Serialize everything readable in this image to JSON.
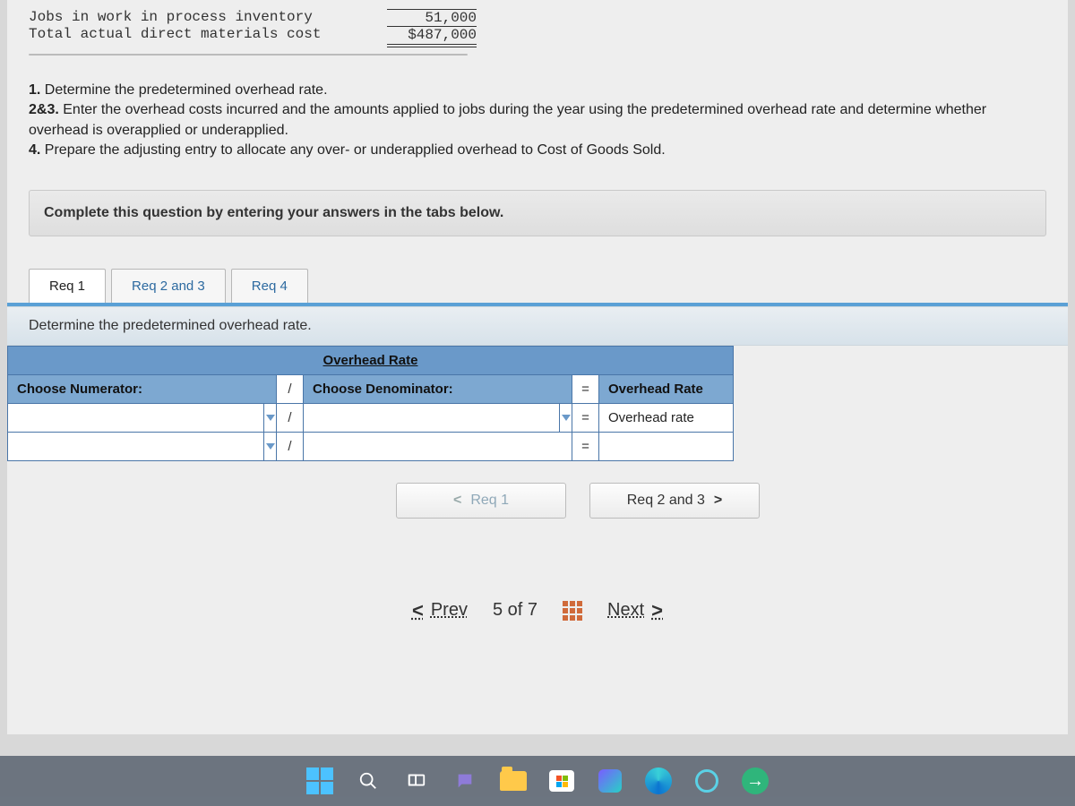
{
  "mono": {
    "row1_label": "Jobs in work in process inventory",
    "row1_value": "51,000",
    "row2_label": "Total actual direct materials cost",
    "row2_value": "$487,000"
  },
  "instructions": {
    "l1b": "1.",
    "l1": " Determine the predetermined overhead rate.",
    "l2b": "2&3.",
    "l2": " Enter the overhead costs incurred and the amounts applied to jobs during the year using the predetermined overhead rate and determine whether overhead is overapplied or underapplied.",
    "l3b": "4.",
    "l3": " Prepare the adjusting entry to allocate any over- or underapplied overhead to Cost of Goods Sold."
  },
  "complete_banner": "Complete this question by entering your answers in the tabs below.",
  "tabs": {
    "t1": "Req 1",
    "t2": "Req 2 and 3",
    "t3": "Req 4"
  },
  "sub_instruction": "Determine the predetermined overhead rate.",
  "table": {
    "header": "Overhead Rate",
    "numerator_label": "Choose Numerator:",
    "slash": "/",
    "denominator_label": "Choose Denominator:",
    "eq": "=",
    "rate_label": "Overhead Rate",
    "rate_value": "Overhead rate"
  },
  "step_nav": {
    "prev_chev": "<",
    "prev": "Req 1",
    "next": "Req 2 and 3",
    "next_chev": ">"
  },
  "pager": {
    "prev_chev": "<",
    "prev": "Prev",
    "count": "5 of 7",
    "next": "Next",
    "next_chev": ">"
  }
}
